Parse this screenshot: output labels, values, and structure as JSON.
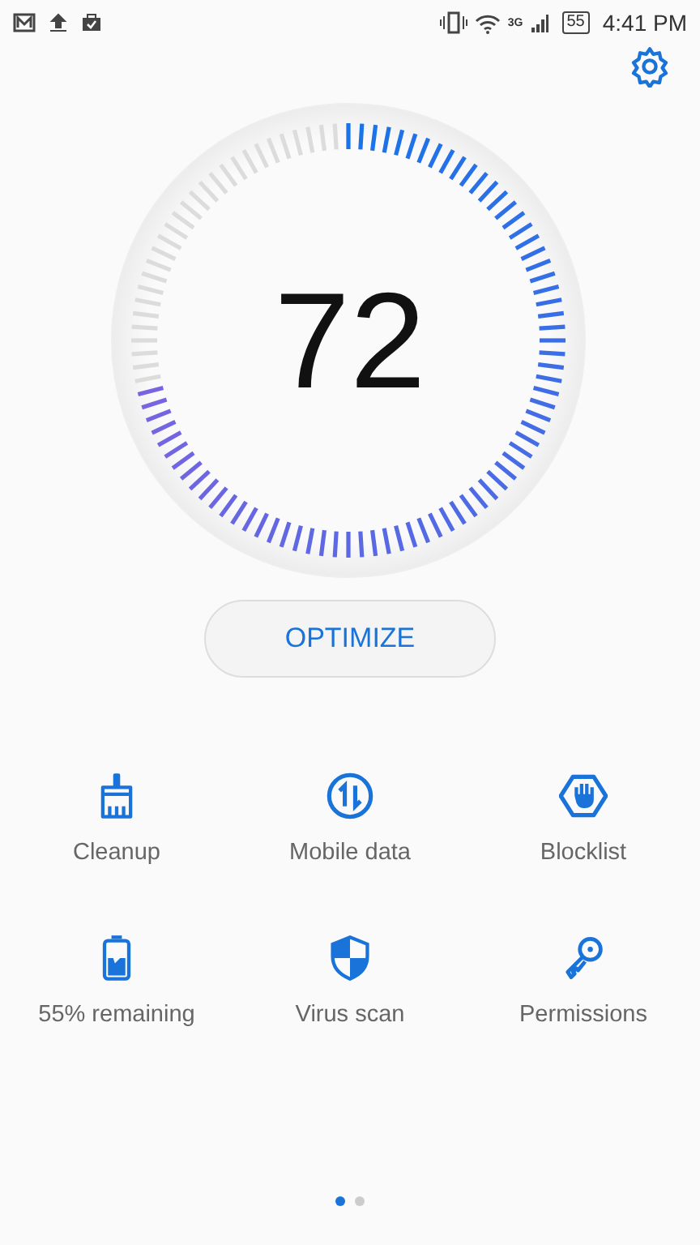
{
  "status_bar": {
    "network": "3G",
    "battery": "55",
    "time": "4:41 PM"
  },
  "score": {
    "value": "72"
  },
  "optimize_button": {
    "label": "OPTIMIZE"
  },
  "tools": [
    {
      "kind": "cleanup",
      "label": "Cleanup"
    },
    {
      "kind": "data",
      "label": "Mobile data"
    },
    {
      "kind": "blocklist",
      "label": "Blocklist"
    },
    {
      "kind": "battery",
      "label": "55% remaining"
    },
    {
      "kind": "virus",
      "label": "Virus scan"
    },
    {
      "kind": "permissions",
      "label": "Permissions"
    }
  ],
  "pager": [
    {
      "selected": true
    },
    {
      "selected": false
    }
  ]
}
